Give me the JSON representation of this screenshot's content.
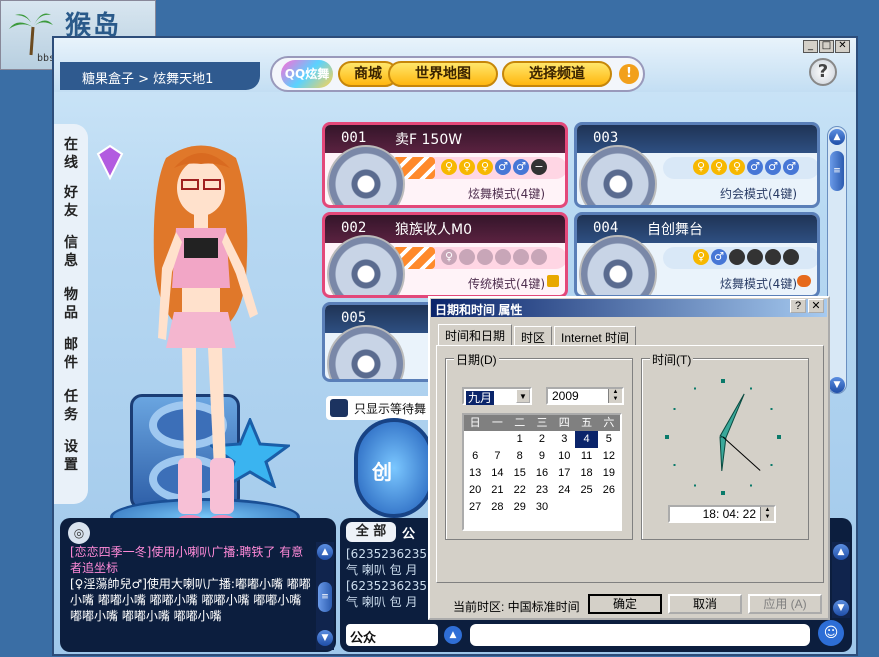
{
  "watermark": {
    "title": "猴岛",
    "url": "bbs.houdao.com"
  },
  "window": {
    "min": "_",
    "max": "□",
    "close": "✕"
  },
  "breadcrumb": "糖果盒子 > 炫舞天地1",
  "nav": {
    "logo": "QQ炫舞",
    "shop": "商城",
    "world_map": "世界地图",
    "select_channel": "选择频道",
    "alert": "!",
    "help": "?"
  },
  "side_menu": [
    [
      "在",
      "线"
    ],
    [
      "好",
      "友"
    ],
    [
      "信",
      "息"
    ],
    [
      "物",
      "品"
    ],
    [
      "邮",
      "件"
    ],
    [
      "任",
      "务"
    ],
    [
      "设",
      "置"
    ]
  ],
  "rooms": [
    {
      "num": "001",
      "name": "卖F 150W",
      "mode": "炫舞模式(4键)"
    },
    {
      "num": "003",
      "name": "",
      "mode": "约会模式(4键)"
    },
    {
      "num": "002",
      "name": "狼族收人M0",
      "mode": "传统模式(4键)"
    },
    {
      "num": "004",
      "name": "自创舞台",
      "mode": "炫舞模式(4键)"
    },
    {
      "num": "005",
      "name": "",
      "mode": ""
    }
  ],
  "slot_symbols": {
    "female": "♀",
    "male": "♂",
    "closed": "−"
  },
  "room_scroll": {
    "up": "▲",
    "down": "▼",
    "thumb": "≡"
  },
  "wait_filter_label": "只显示等待舞",
  "create_label": "创",
  "chat_left": {
    "icon": "◎",
    "lines": [
      {
        "text": "[恋恋四季一冬]使用小喇叭广播:聘铁了    有意者追坐标",
        "style": "pink"
      },
      {
        "text": "[♀淫蕩帥兒♂]使用大喇叭广播:嘟嘟小嘴  嘟嘟小嘴  嘟嘟小嘴  嘟嘟小嘴  嘟嘟小嘴  嘟嘟小嘴  嘟嘟小嘴  嘟嘟小嘴  嘟嘟小嘴",
        "style": "white"
      }
    ]
  },
  "chat_right": {
    "tab_all": "全 部",
    "tab_public": "公",
    "lines": [
      "[6235236235]",
      "气 喇叭 包 月",
      "[6235236235]",
      "气 喇叭 包 月"
    ],
    "channel": "公众",
    "channel_btn": "▲",
    "smiley": "☺"
  },
  "dialog": {
    "title": "日期和时间 属性",
    "help": "?",
    "close": "✕",
    "tabs": [
      "时间和日期",
      "时区",
      "Internet 时间"
    ],
    "date_group": "日期",
    "date_accel": "(D)",
    "month": "九月",
    "year": "2009",
    "weekdays": [
      "日",
      "一",
      "二",
      "三",
      "四",
      "五",
      "六"
    ],
    "days": [
      "",
      "",
      "1",
      "2",
      "3",
      "4",
      "5",
      "6",
      "7",
      "8",
      "9",
      "10",
      "11",
      "12",
      "13",
      "14",
      "15",
      "16",
      "17",
      "18",
      "19",
      "20",
      "21",
      "22",
      "23",
      "24",
      "25",
      "26",
      "27",
      "28",
      "29",
      "30"
    ],
    "selected_day": "4",
    "time_group": "时间",
    "time_accel": "(T)",
    "time": "18: 04: 22",
    "tz_label": "当前时区: 中国标准时间",
    "ok": "确定",
    "cancel": "取消",
    "apply": "应用 (A)",
    "clock": {
      "hour": 18,
      "minute": 4,
      "second": 22
    }
  }
}
